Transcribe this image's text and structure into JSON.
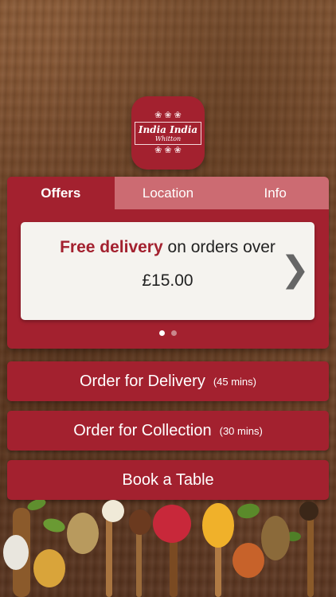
{
  "logo": {
    "name": "India India",
    "sub": "Whitton",
    "ornament_top": "❀ ❀ ❀",
    "ornament_bottom": "❀ ❀ ❀"
  },
  "tabs": [
    {
      "label": "Offers",
      "active": true
    },
    {
      "label": "Location",
      "active": false
    },
    {
      "label": "Info",
      "active": false
    }
  ],
  "offer": {
    "highlight": "Free delivery",
    "text": "on orders over",
    "amount": "£15.00",
    "next_icon": "chevron-right-icon",
    "next_glyph": "❯"
  },
  "pager": {
    "total": 2,
    "current": 1
  },
  "buttons": {
    "delivery": {
      "label": "Order for Delivery",
      "time": "(45 mins)"
    },
    "collection": {
      "label": "Order for Collection",
      "time": "(30 mins)"
    },
    "book": {
      "label": "Book a Table"
    }
  },
  "colors": {
    "brand": "#a3212f",
    "tab_inactive": "#cc6b72",
    "card": "#f5f3ef"
  }
}
